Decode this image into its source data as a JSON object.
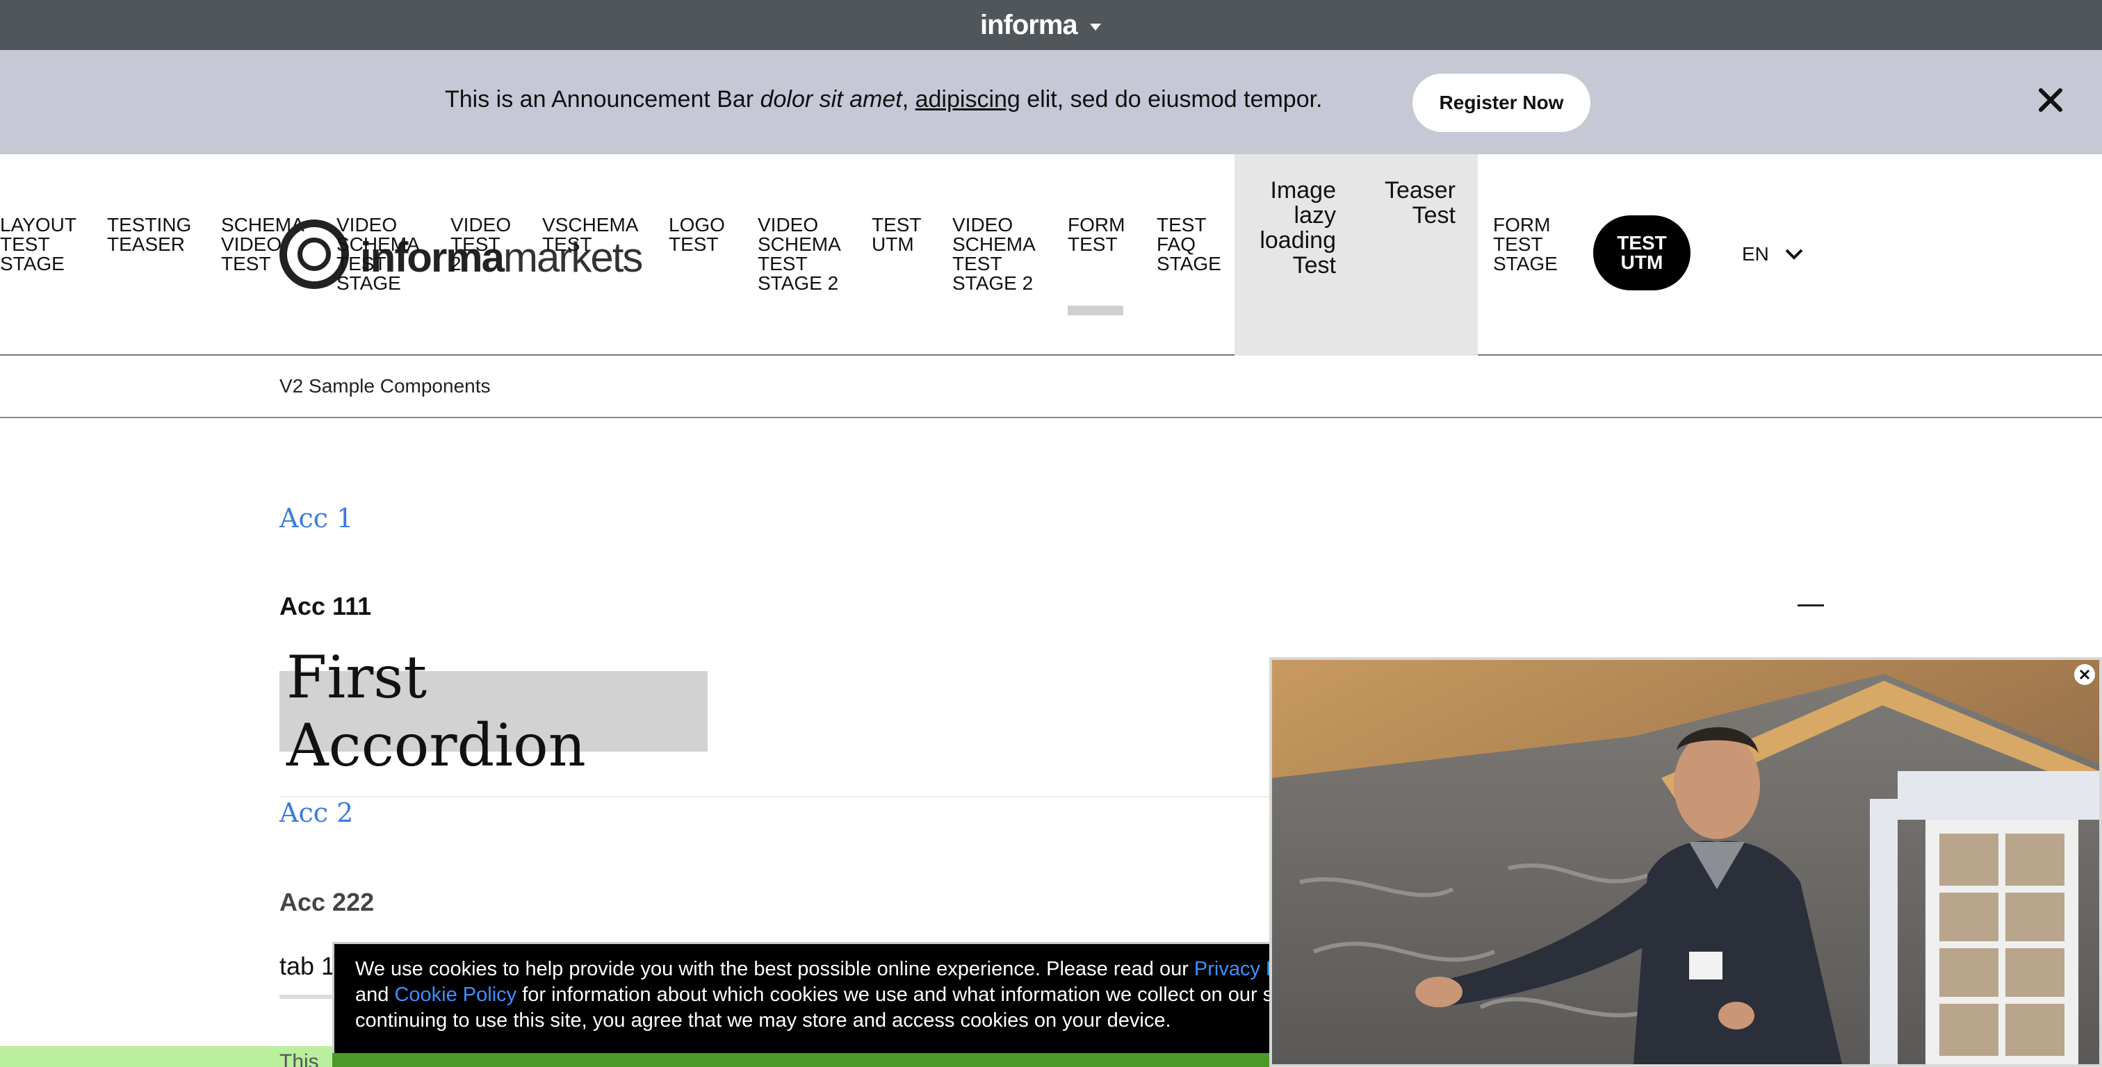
{
  "topbar": {
    "brand": "informa"
  },
  "announcement": {
    "text_prefix": "This is an ",
    "text_bold": "Announcement Bar",
    "text_italic": "dolor sit amet",
    "text_comma": ", ",
    "text_link": "adipiscing",
    "text_suffix": " elit, sed do eiusmod tempor.",
    "button_label": "Register Now"
  },
  "nav": {
    "items": [
      {
        "lines": [
          "LAYOUT",
          "TEST",
          "STAGE"
        ]
      },
      {
        "lines": [
          "TESTING",
          "TEASER"
        ]
      },
      {
        "lines": [
          "SCHEMA",
          "VIDEO",
          "TEST"
        ]
      },
      {
        "lines": [
          "VIDEO",
          "SCHEMA",
          "TEST",
          "STAGE"
        ]
      },
      {
        "lines": [
          "VIDEO",
          "TEST",
          "2"
        ]
      },
      {
        "lines": [
          "VSCHEMA",
          "TEST"
        ]
      },
      {
        "lines": [
          "LOGO",
          "TEST"
        ]
      },
      {
        "lines": [
          "VIDEO",
          "SCHEMA",
          "TEST",
          "STAGE 2"
        ]
      },
      {
        "lines": [
          "TEST",
          "UTM"
        ]
      },
      {
        "lines": [
          "VIDEO",
          "SCHEMA",
          "TEST",
          "STAGE 2"
        ]
      },
      {
        "lines": [
          "FORM",
          "TEST"
        ]
      },
      {
        "lines": [
          "TEST",
          "FAQ",
          "STAGE"
        ]
      },
      {
        "lines": [
          "FORM",
          "TEST",
          "STAGE"
        ]
      }
    ],
    "image_lazy": [
      "Image",
      "lazy",
      "loading",
      "Test"
    ],
    "teaser_test": [
      "Teaser",
      "Test"
    ],
    "logo_bold": "informa",
    "logo_light": "markets",
    "utm_button": [
      "TEST",
      "UTM"
    ],
    "language": "EN"
  },
  "breadcrumb": "V2 Sample Components",
  "content": {
    "acc1": "Acc 1",
    "acc111": "Acc 111",
    "first_accordion": "First Accordion",
    "acc2": "Acc 2",
    "acc222": "Acc 222",
    "tab1": "tab 1",
    "green_text": "This"
  },
  "cookie": {
    "part1": "We use cookies to help provide you with the best possible online experience. Please read our ",
    "link_privacy": "Privacy Policy",
    "part2": " and ",
    "link_cookie": "Cookie Policy",
    "part3": " for information about which cookies we use and what information we collect on our site. By continuing to use this site, you agree that we may store and access cookies on your device."
  },
  "colors": {
    "topbar": "#51565a",
    "announcement": "#c6c8d6",
    "link_blue": "#3b7be0",
    "cookie_link": "#3e8fff",
    "utm_button": "#000000"
  }
}
